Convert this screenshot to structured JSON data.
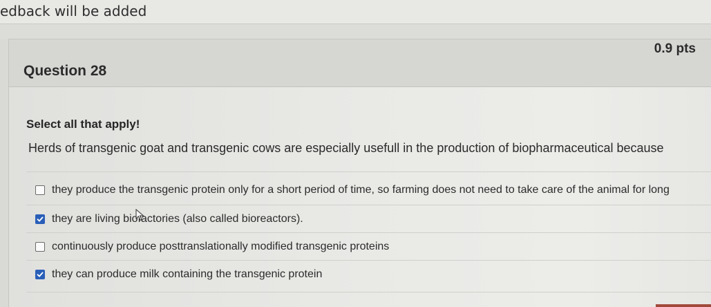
{
  "previous_question": {
    "feedback_text": "edback will be added"
  },
  "question": {
    "title": "Question 28",
    "points": "0.9 pts",
    "instruction": "Select all that apply!",
    "prompt": "Herds of transgenic goat and transgenic cows are especially usefull in the production of biopharmaceutical because",
    "answers": [
      {
        "label": "they produce the transgenic protein only for a short period of time, so farming does not need to take care of the animal for long",
        "checked": false
      },
      {
        "label": "they are living biofactories (also called bioreactors).",
        "checked": true
      },
      {
        "label": "continuously produce posttranslationally modified transgenic proteins",
        "checked": false
      },
      {
        "label": "they can produce milk containing the transgenic protein",
        "checked": true
      }
    ]
  },
  "colors": {
    "checkbox_checked": "#2a5fb8"
  },
  "icons": {
    "cursor": "mouse-pointer-icon",
    "check": "checkmark-icon"
  }
}
